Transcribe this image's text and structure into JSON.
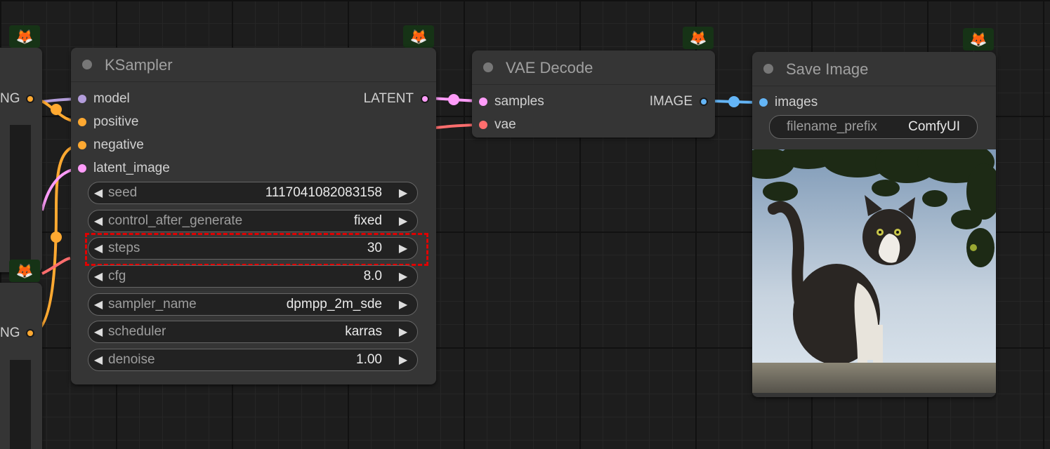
{
  "colors": {
    "model": "#b39ddb",
    "clip_conditioning": "#ffa931",
    "latent": "#ff9cf9",
    "vae": "#ff6e6e",
    "image": "#64b5f6",
    "highlight": "#e10000"
  },
  "badge_icon": "🦊",
  "left_edge_nodes": {
    "top_output_label": "NG",
    "bottom_output_label": "NG"
  },
  "ksampler": {
    "title": "KSampler",
    "inputs": [
      "model",
      "positive",
      "negative",
      "latent_image"
    ],
    "output": "LATENT",
    "widgets": [
      {
        "label": "seed",
        "value": "1117041082083158"
      },
      {
        "label": "control_after_generate",
        "value": "fixed"
      },
      {
        "label": "steps",
        "value": "30"
      },
      {
        "label": "cfg",
        "value": "8.0"
      },
      {
        "label": "sampler_name",
        "value": "dpmpp_2m_sde"
      },
      {
        "label": "scheduler",
        "value": "karras"
      },
      {
        "label": "denoise",
        "value": "1.00"
      }
    ],
    "highlighted_widget": "steps"
  },
  "vae_decode": {
    "title": "VAE Decode",
    "inputs": [
      "samples",
      "vae"
    ],
    "output": "IMAGE"
  },
  "save_image": {
    "title": "Save Image",
    "input": "images",
    "filename_prefix_label": "filename_prefix",
    "filename_prefix_value": "ComfyUI",
    "preview_icon": "cat-photo"
  }
}
